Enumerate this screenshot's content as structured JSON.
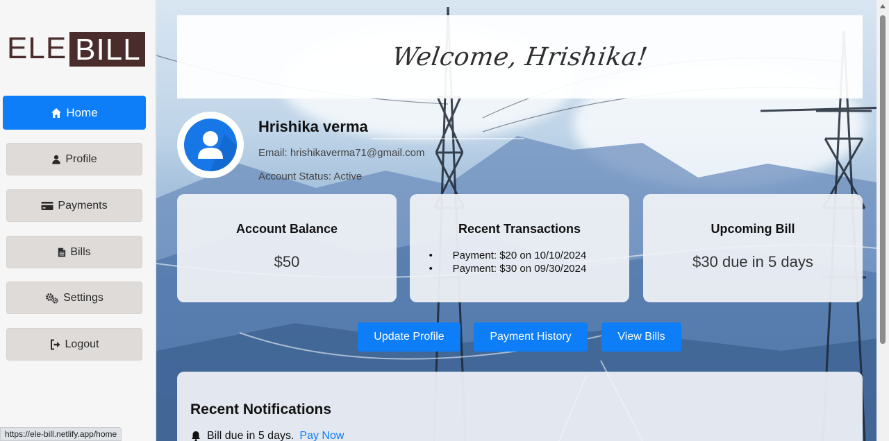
{
  "app": {
    "logo_left": "ELE",
    "logo_right": "BILL"
  },
  "sidebar": {
    "items": [
      {
        "label": "Home",
        "icon": "home-icon",
        "active": true
      },
      {
        "label": "Profile",
        "icon": "user-icon",
        "active": false
      },
      {
        "label": "Payments",
        "icon": "credit-card-icon",
        "active": false
      },
      {
        "label": "Bills",
        "icon": "file-icon",
        "active": false
      },
      {
        "label": "Settings",
        "icon": "cogs-icon",
        "active": false
      },
      {
        "label": "Logout",
        "icon": "sign-out-icon",
        "active": false
      }
    ]
  },
  "header": {
    "welcome": "Welcome, Hrishika!"
  },
  "user": {
    "name": "Hrishika verma",
    "email": "Email: hrishikaverma71@gmail.com",
    "status": "Account Status: Active"
  },
  "cards": {
    "balance": {
      "title": "Account Balance",
      "value": "$50"
    },
    "transactions": {
      "title": "Recent Transactions",
      "items": [
        "Payment: $20 on 10/10/2024",
        "Payment: $30 on 09/30/2024"
      ]
    },
    "upcoming": {
      "title": "Upcoming Bill",
      "value": "$30 due in 5 days"
    }
  },
  "actions": {
    "update_profile": "Update Profile",
    "payment_history": "Payment History",
    "view_bills": "View Bills"
  },
  "notifications": {
    "title": "Recent Notifications",
    "items": [
      {
        "text": "Bill due in 5 days.",
        "link": "Pay Now",
        "icon": "bell-icon"
      }
    ]
  },
  "browser": {
    "status_url": "https://ele-bill.netlify.app/home"
  },
  "colors": {
    "primary": "#0d7df8",
    "logo": "#4a2c2c",
    "nav_bg": "#dedbd9"
  }
}
